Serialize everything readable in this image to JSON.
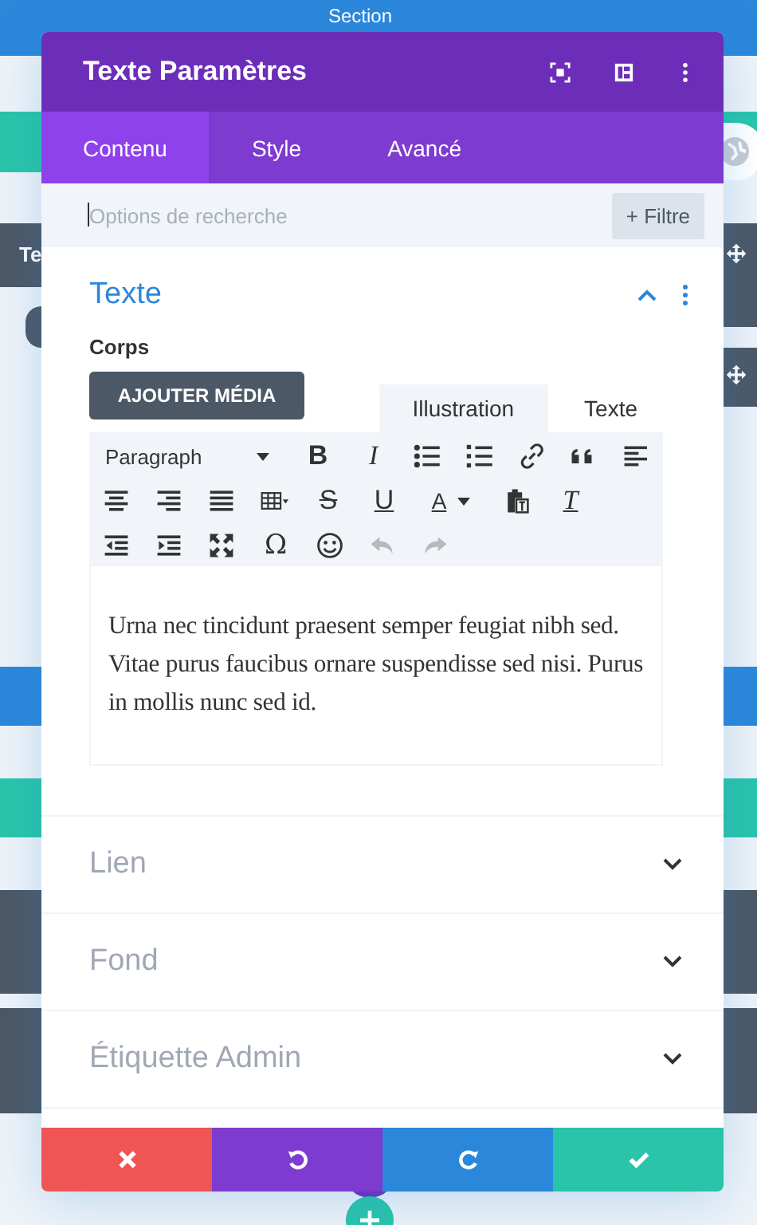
{
  "background": {
    "section_label": "Section",
    "module_label": "Te"
  },
  "modal": {
    "title": "Texte Paramètres",
    "tabs": [
      {
        "label": "Contenu",
        "selected": true
      },
      {
        "label": "Style",
        "selected": false
      },
      {
        "label": "Avancé",
        "selected": false
      }
    ],
    "search": {
      "placeholder": "Options de recherche",
      "filter_button": "+ Filtre"
    },
    "sections": [
      {
        "title": "Texte",
        "expanded": true,
        "body": {
          "field_label": "Corps",
          "media_button": "AJOUTER MÉDIA",
          "editor_tabs": [
            {
              "label": "Illustration",
              "selected": true
            },
            {
              "label": "Texte",
              "selected": false
            }
          ],
          "toolbar": [
            [
              {
                "kind": "format",
                "text": "Paragraph",
                "disabled": false
              },
              {
                "kind": "bold",
                "text": "B",
                "disabled": false
              },
              {
                "kind": "italic",
                "text": "I",
                "disabled": false
              },
              {
                "kind": "bullets",
                "disabled": false
              },
              {
                "kind": "numbers",
                "disabled": false
              },
              {
                "kind": "link",
                "disabled": false
              },
              {
                "kind": "quote",
                "disabled": false
              },
              {
                "kind": "align-left",
                "disabled": false
              }
            ],
            [
              {
                "kind": "align-center",
                "disabled": false
              },
              {
                "kind": "align-right",
                "disabled": false
              },
              {
                "kind": "justify",
                "disabled": false
              },
              {
                "kind": "table",
                "disabled": false
              },
              {
                "kind": "strike",
                "text": "S",
                "disabled": false
              },
              {
                "kind": "underline",
                "text": "U",
                "disabled": false
              },
              {
                "kind": "color",
                "text": "A",
                "disabled": false
              },
              {
                "kind": "paste",
                "disabled": false
              },
              {
                "kind": "clear",
                "text": "T",
                "disabled": false
              }
            ],
            [
              {
                "kind": "outdent",
                "disabled": false
              },
              {
                "kind": "indent",
                "disabled": false
              },
              {
                "kind": "fullscreen",
                "disabled": false
              },
              {
                "kind": "special",
                "text": "Ω",
                "disabled": false
              },
              {
                "kind": "emoji",
                "disabled": false
              },
              {
                "kind": "undo",
                "disabled": true
              },
              {
                "kind": "redo",
                "disabled": true
              }
            ]
          ],
          "content": "Urna nec tincidunt praesent semper feugiat nibh sed. Vitae purus faucibus ornare suspendisse sed nisi. Purus in mollis nunc sed id."
        }
      },
      {
        "title": "Lien",
        "expanded": false
      },
      {
        "title": "Fond",
        "expanded": false
      },
      {
        "title": "Étiquette Admin",
        "expanded": false
      }
    ],
    "footer": [
      {
        "kind": "cancel"
      },
      {
        "kind": "undo"
      },
      {
        "kind": "redo"
      },
      {
        "kind": "save"
      }
    ]
  }
}
